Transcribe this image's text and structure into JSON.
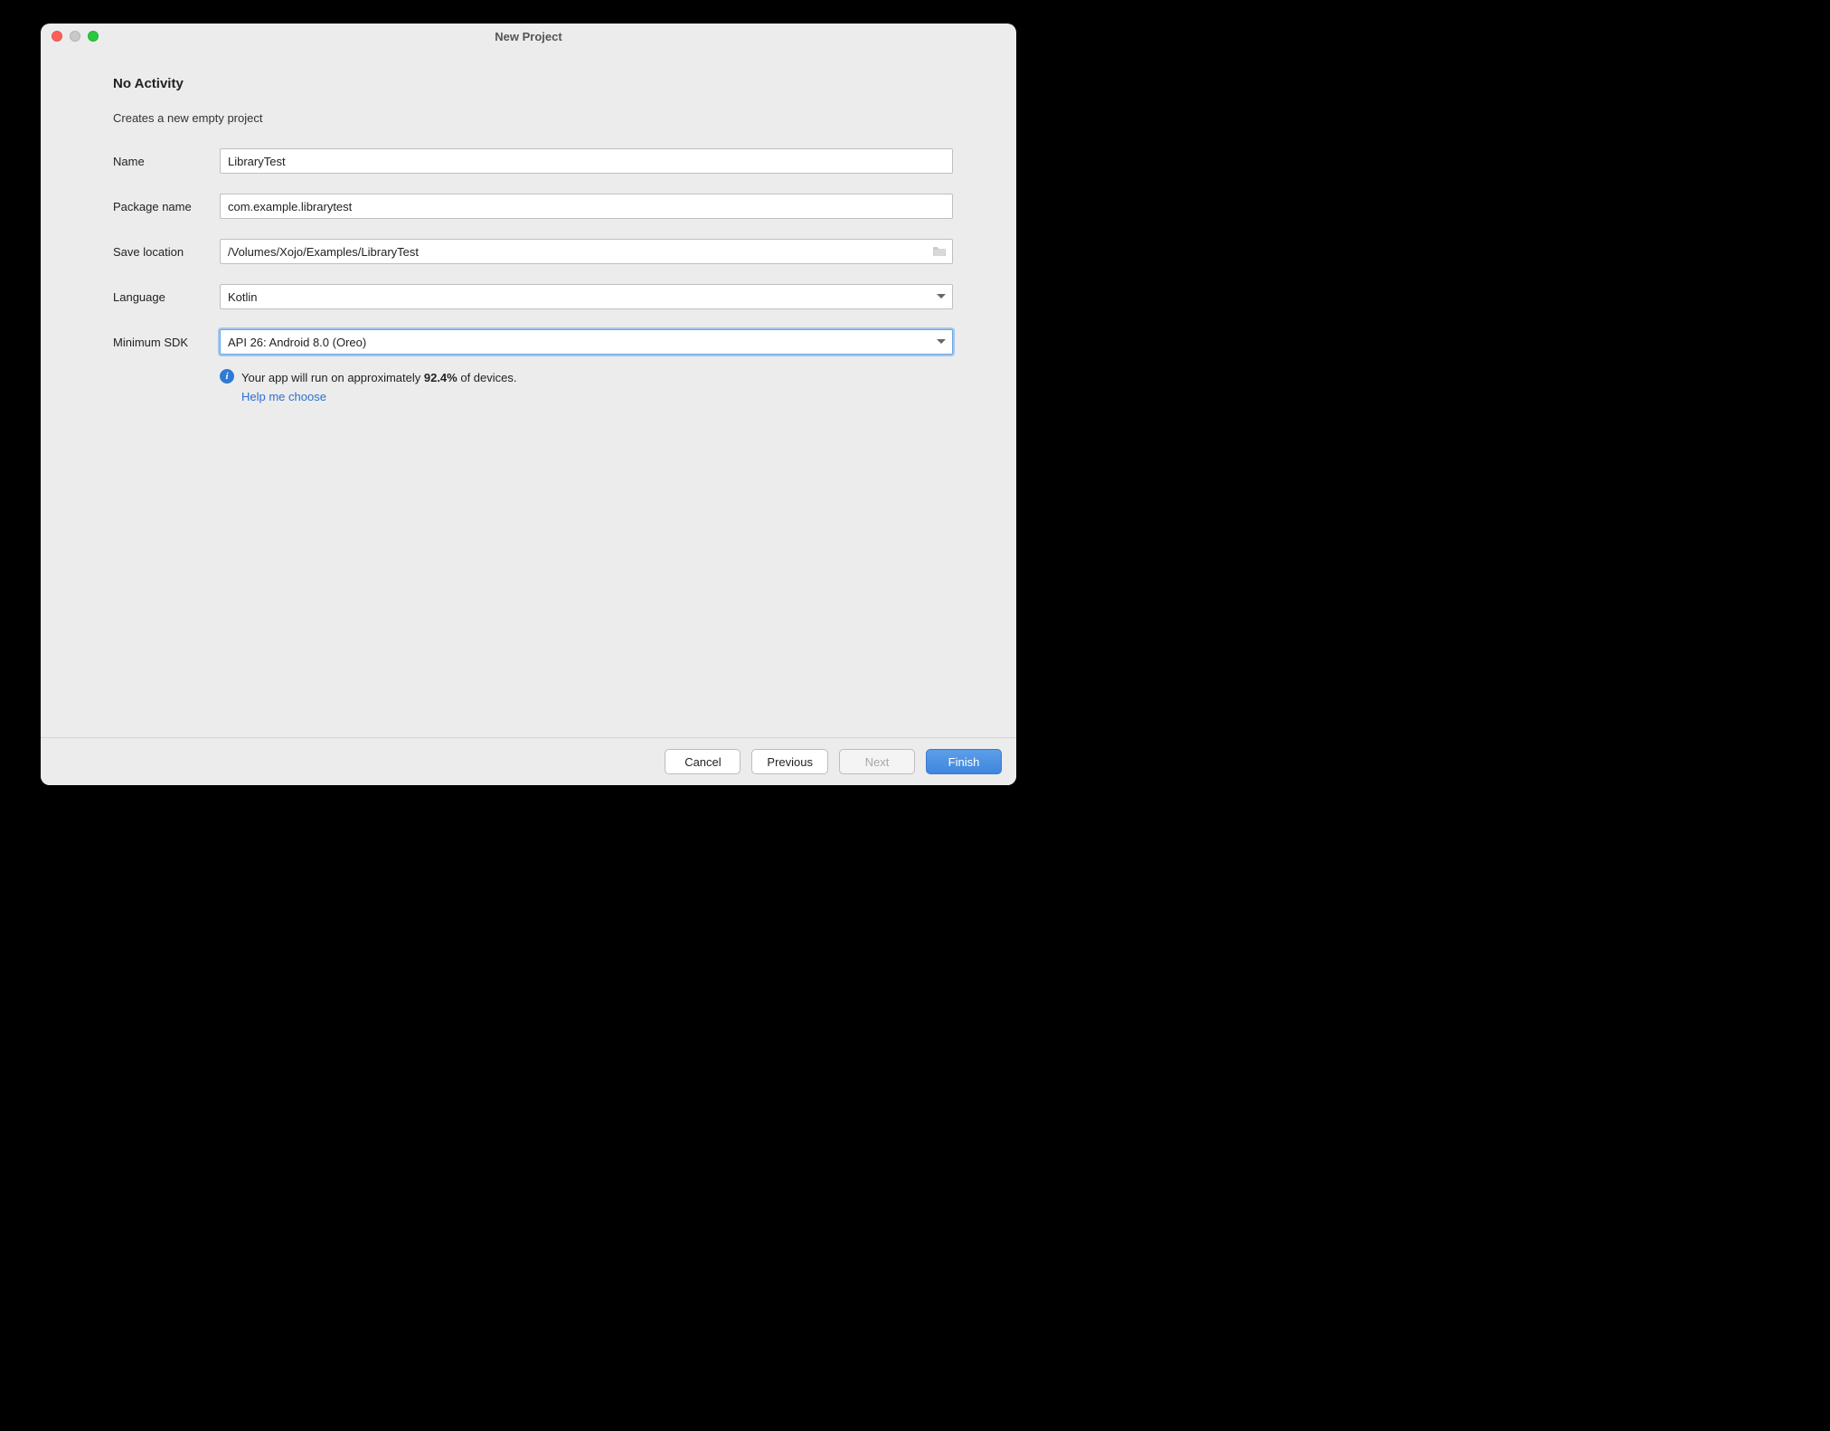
{
  "window": {
    "title": "New Project"
  },
  "heading": "No Activity",
  "subtitle": "Creates a new empty project",
  "form": {
    "name_label": "Name",
    "name_value": "LibraryTest",
    "package_label": "Package name",
    "package_value": "com.example.librarytest",
    "location_label": "Save location",
    "location_value": "/Volumes/Xojo/Examples/LibraryTest",
    "language_label": "Language",
    "language_value": "Kotlin",
    "minsdk_label": "Minimum SDK",
    "minsdk_value": "API 26: Android 8.0 (Oreo)"
  },
  "info": {
    "prefix": "Your app will run on approximately ",
    "pct": "92.4%",
    "suffix": " of devices.",
    "help": "Help me choose"
  },
  "buttons": {
    "cancel": "Cancel",
    "previous": "Previous",
    "next": "Next",
    "finish": "Finish"
  }
}
